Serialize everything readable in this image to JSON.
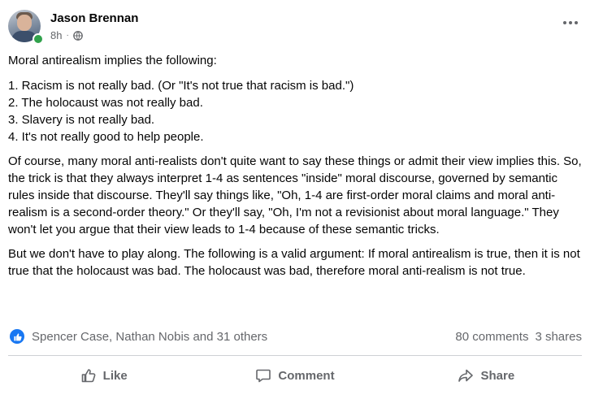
{
  "post": {
    "author": "Jason Brennan",
    "time": "8h",
    "separator": "·",
    "intro": "Moral antirealism implies the following:",
    "list": [
      "1. Racism is not really bad. (Or \"It's not true that racism is bad.\")",
      "2. The holocaust was not really bad.",
      "3. Slavery is not really bad.",
      "4. It's not really good to help people."
    ],
    "paragraphs": [
      "Of course, many moral anti-realists don't quite want to say these things or admit their view implies this. So, the trick is that they always interpret 1-4 as sentences \"inside\" moral discourse, governed by semantic rules inside that discourse. They'll say things like, \"Oh, 1-4 are first-order moral claims and moral anti-realism is a second-order theory.\" Or they'll say, \"Oh, I'm not a revisionist about moral language.\" They won't let you argue that their view leads to 1-4 because of these semantic tricks.",
      "But we don't have to play along. The following is a valid argument: If moral antirealism is true, then it is not true that the holocaust was bad. The holocaust was bad, therefore moral anti-realism is not true."
    ]
  },
  "stats": {
    "reactors": "Spencer Case, Nathan Nobis and 31 others",
    "comments": "80 comments",
    "shares": "3 shares"
  },
  "actions": {
    "like": "Like",
    "comment": "Comment",
    "share": "Share"
  },
  "icons": {
    "privacy": "globe-icon",
    "menu": "more-options-icon",
    "reaction": "like-reaction-icon",
    "like": "thumbs-up-icon",
    "comment": "comment-icon",
    "share": "share-icon"
  },
  "colors": {
    "accent": "#1877f2",
    "online": "#31a24c",
    "secondary_text": "#65676b",
    "primary_text": "#050505",
    "divider": "#ced0d4"
  }
}
